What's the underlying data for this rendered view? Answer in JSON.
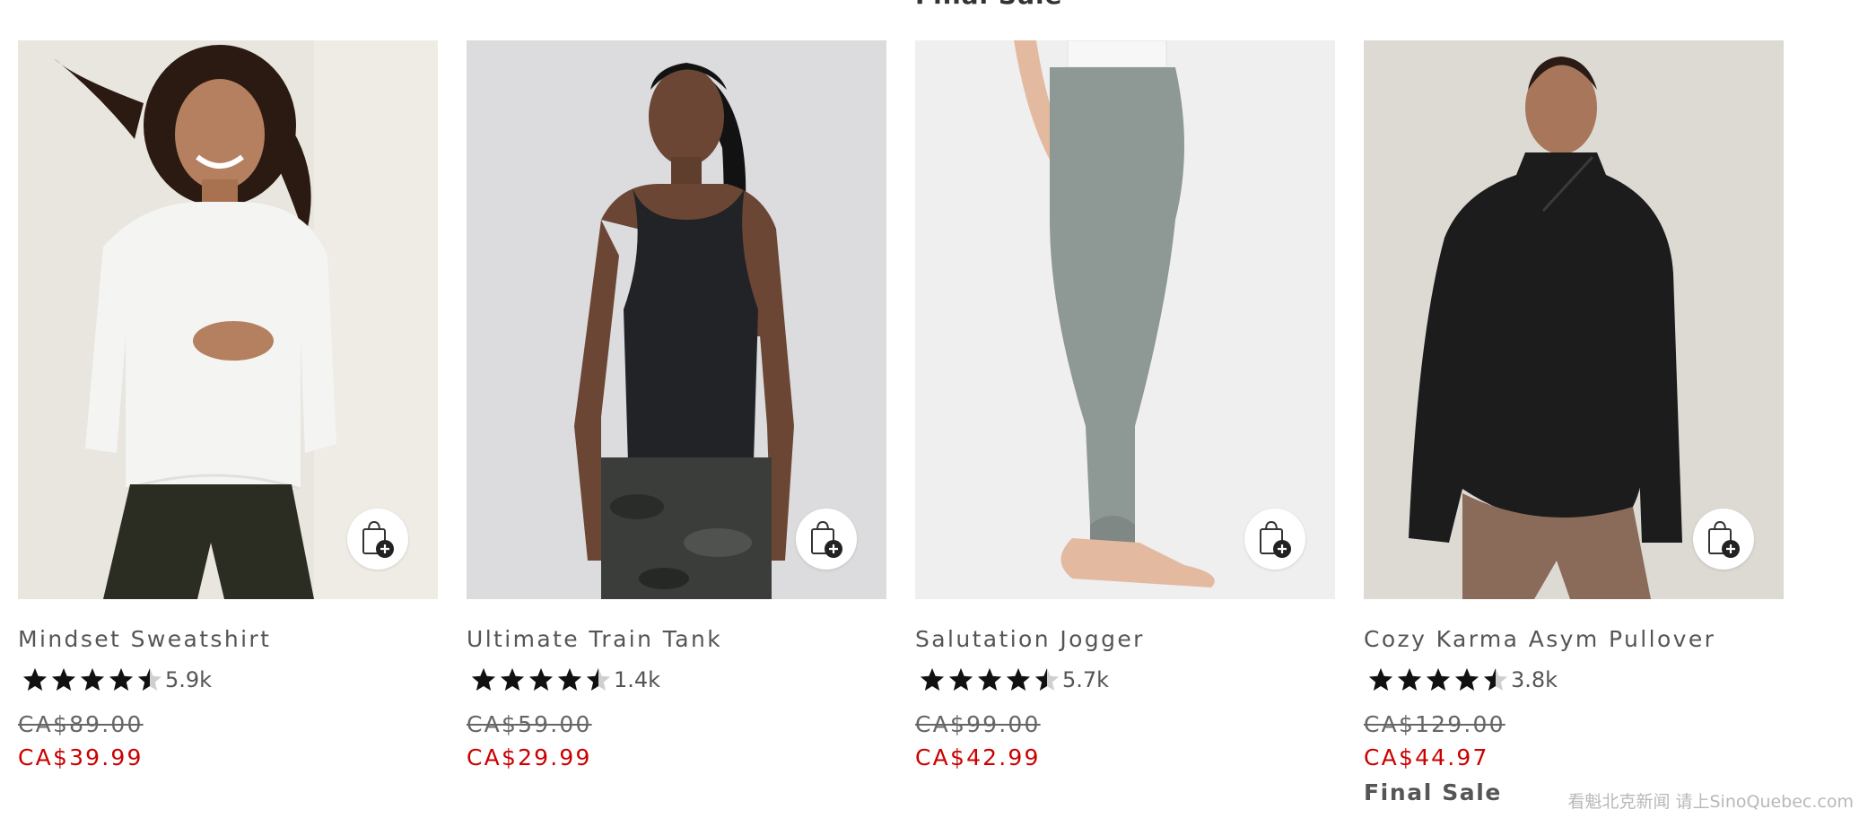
{
  "top_label_clipped": "Final Sale",
  "products": [
    {
      "name": "Mindset Sweatshirt",
      "rating": 4.5,
      "review_count": "5.9k",
      "original_price": "CA$89.00",
      "sale_price": "CA$39.99",
      "final_sale": "",
      "image_colors": {
        "background": "#e9e6e0",
        "top": "#f4f4f2",
        "bottom": "#2b2d22",
        "skin": "#b5805f",
        "hair": "#2a1a12"
      }
    },
    {
      "name": "Ultimate Train Tank",
      "rating": 4.5,
      "review_count": "1.4k",
      "original_price": "CA$59.00",
      "sale_price": "CA$29.99",
      "final_sale": "",
      "image_colors": {
        "background": "#dcdcde",
        "top": "#222326",
        "bottom": "#3b3d3a",
        "skin": "#6b4634",
        "hair": "#121212"
      }
    },
    {
      "name": "Salutation Jogger",
      "rating": 4.5,
      "review_count": "5.7k",
      "original_price": "CA$99.00",
      "sale_price": "CA$42.99",
      "final_sale": "",
      "image_colors": {
        "background": "#efefef",
        "top": "#f7f7f7",
        "bottom": "#8e9894",
        "skin": "#e3b9a0",
        "hair": "#000000"
      }
    },
    {
      "name": "Cozy Karma Asym Pullover",
      "rating": 4.5,
      "review_count": "3.8k",
      "original_price": "CA$129.00",
      "sale_price": "CA$44.97",
      "final_sale": "Final Sale",
      "image_colors": {
        "background": "#dddad4",
        "top": "#1c1c1d",
        "bottom": "#8a6a58",
        "skin": "#a8775b",
        "hair": "#2a1c14"
      }
    }
  ],
  "icons": {
    "add_to_bag": "shopping-bag-plus-icon",
    "star": "star-icon"
  },
  "colors": {
    "sale_price": "#cc0000",
    "star": "#111111",
    "text": "#555555"
  },
  "watermark": "看魁北克新闻 请上SinoQuebec.com"
}
